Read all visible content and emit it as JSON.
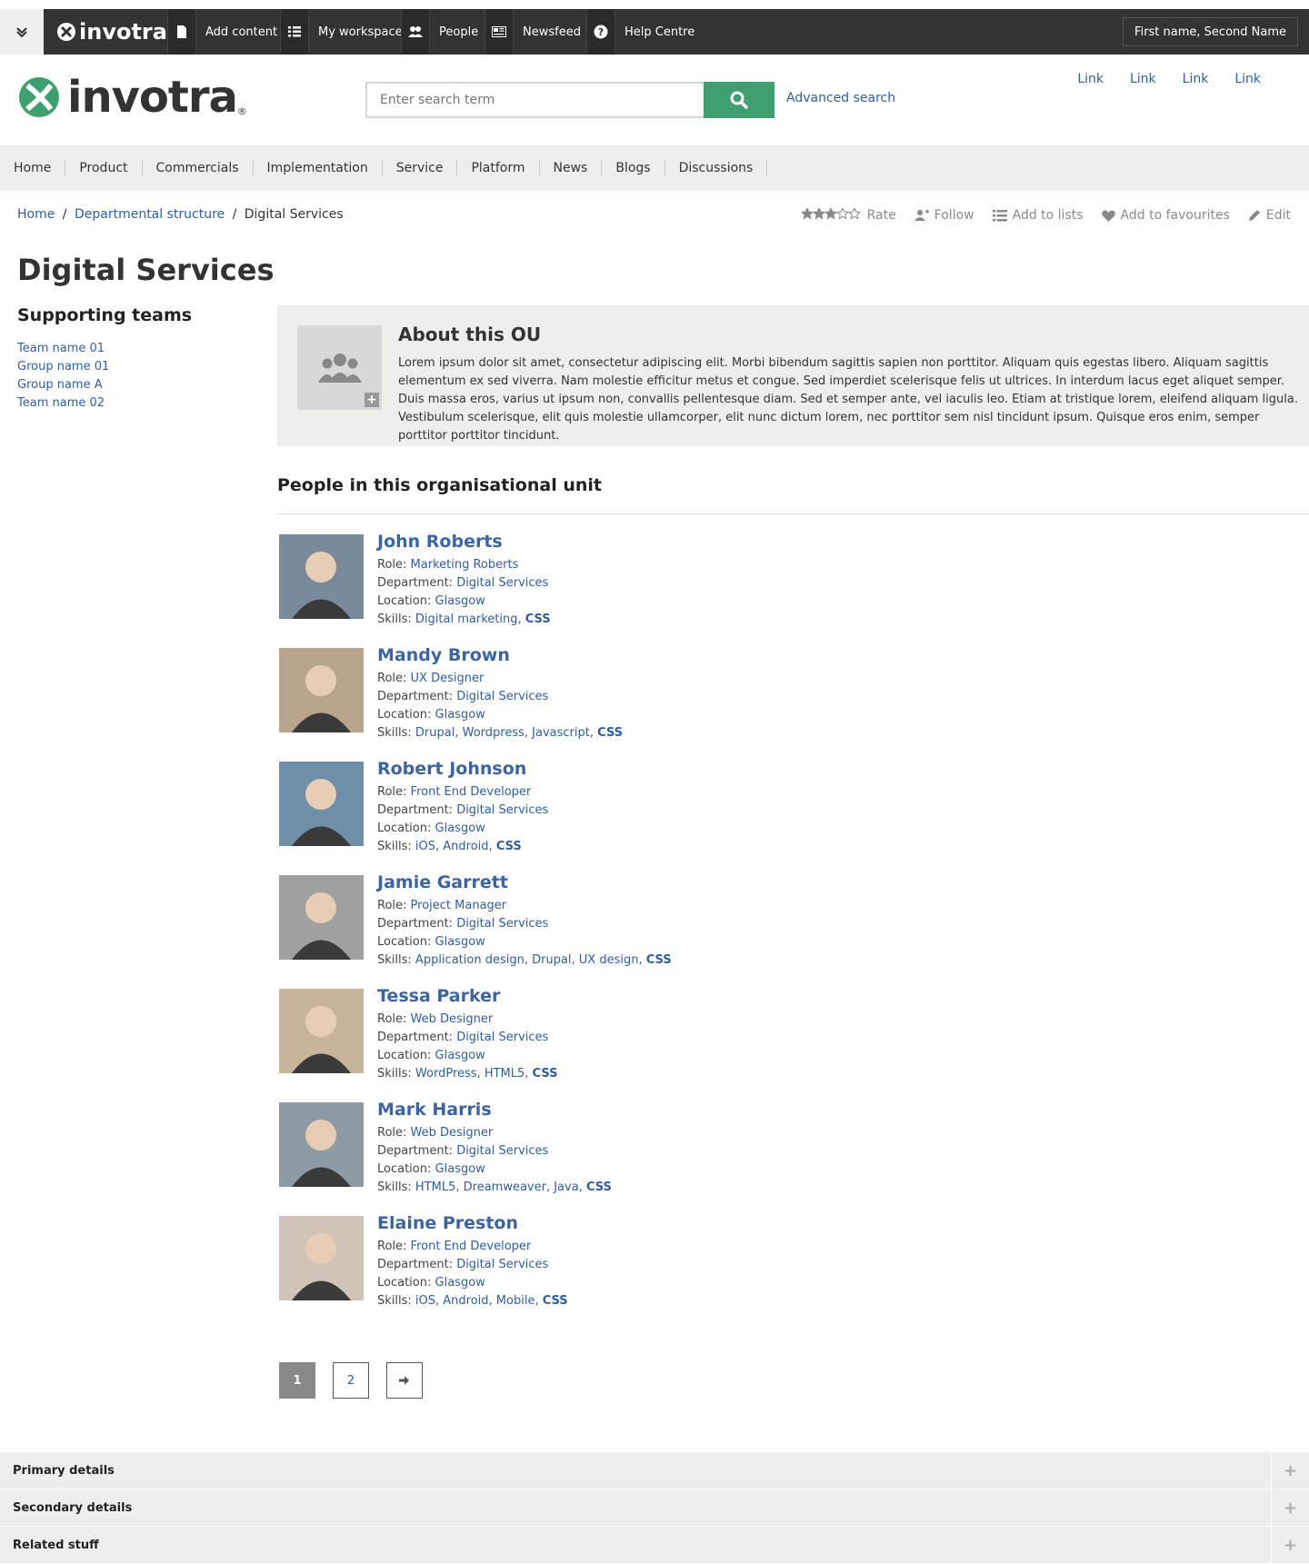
{
  "admin_bar": {
    "logo_text": "invotra",
    "items": [
      {
        "label": "Add content",
        "icon": "document-icon"
      },
      {
        "label": "My workspace",
        "icon": "list-icon"
      },
      {
        "label": "People",
        "icon": "people-icon"
      },
      {
        "label": "Newsfeed",
        "icon": "newspaper-icon"
      },
      {
        "label": "Help Centre",
        "icon": "question-icon"
      }
    ],
    "user_name": "First name, Second Name"
  },
  "header": {
    "logo_text": "invotra",
    "search_placeholder": "Enter search term",
    "advanced_search": "Advanced search",
    "top_links": [
      "Link",
      "Link",
      "Link",
      "Link"
    ]
  },
  "nav": {
    "items": [
      "Home",
      "Product",
      "Commercials",
      "Implementation",
      "Service",
      "Platform",
      "News",
      "Blogs",
      "Discussions"
    ]
  },
  "breadcrumb": {
    "items": [
      "Home",
      "Departmental structure",
      "Digital Services"
    ]
  },
  "actions": {
    "rate": "Rate",
    "follow": "Follow",
    "add_to_lists": "Add to lists",
    "add_to_favourites": "Add to favourites",
    "edit": "Edit",
    "rating": 3
  },
  "page": {
    "title": "Digital Services"
  },
  "sidebar": {
    "title": "Supporting teams",
    "teams": [
      "Team name 01",
      "Group name 01",
      "Group name A",
      "Team name 02"
    ]
  },
  "about": {
    "title": "About this OU",
    "text": "Lorem ipsum dolor sit amet, consectetur adipiscing elit. Morbi bibendum sagittis sapien non porttitor. Aliquam quis egestas libero. Aliquam sagittis elementum ex sed viverra. Nam molestie efficitur metus et congue. Sed imperdiet scelerisque felis ut ultrices. In interdum lacus eget aliquet semper. Duis massa eros, varius ut ipsum non, convallis pellentesque diam. Sed et semper ante, vel iaculis leo. Etiam at tristique lorem, eleifend aliquam ligula. Vestibulum scelerisque, elit quis molestie ullamcorper, elit nunc dictum lorem, nec porttitor sem nisl tincidunt ipsum. Quisque eros enim, semper porttitor porttitor tincidunt."
  },
  "people": {
    "heading": "People in this organisational unit",
    "labels": {
      "role": "Role:",
      "department": "Department:",
      "location": "Location:",
      "skills": "Skills:"
    },
    "list": [
      {
        "name": "John Roberts",
        "role": "Marketing Roberts",
        "department": "Digital Services",
        "location": "Glasgow",
        "skills": "Digital marketing,",
        "css": "CSS"
      },
      {
        "name": "Mandy Brown",
        "role": "UX Designer",
        "department": "Digital Services",
        "location": "Glasgow",
        "skills": "Drupal, Wordpress, Javascript,",
        "css": "CSS"
      },
      {
        "name": "Robert Johnson",
        "role": "Front End Developer",
        "department": "Digital Services",
        "location": "Glasgow",
        "skills": "iOS, Android,",
        "css": "CSS"
      },
      {
        "name": "Jamie Garrett",
        "role": "Project Manager",
        "department": "Digital Services",
        "location": "Glasgow",
        "skills": "Application design, Drupal, UX design,",
        "css": "CSS"
      },
      {
        "name": "Tessa Parker",
        "role": "Web Designer",
        "department": "Digital Services",
        "location": "Glasgow",
        "skills": "WordPress, HTML5,",
        "css": "CSS"
      },
      {
        "name": "Mark Harris",
        "role": "Web Designer",
        "department": "Digital Services",
        "location": "Glasgow",
        "skills": "HTML5, Dreamweaver, Java,",
        "css": "CSS"
      },
      {
        "name": "Elaine Preston",
        "role": "Front End Developer",
        "department": "Digital Services",
        "location": "Glasgow",
        "skills": "iOS, Android, Mobile,",
        "css": "CSS"
      }
    ]
  },
  "pagination": {
    "pages": [
      "1",
      "2"
    ],
    "current": "1"
  },
  "accordion": {
    "items": [
      "Primary details",
      "Secondary details",
      "Related stuff"
    ]
  },
  "colors": {
    "brand_green": "#3f9f70",
    "link_blue": "#2f5e9e",
    "admin_bar": "#333333",
    "nav_bg": "#efeeea"
  }
}
